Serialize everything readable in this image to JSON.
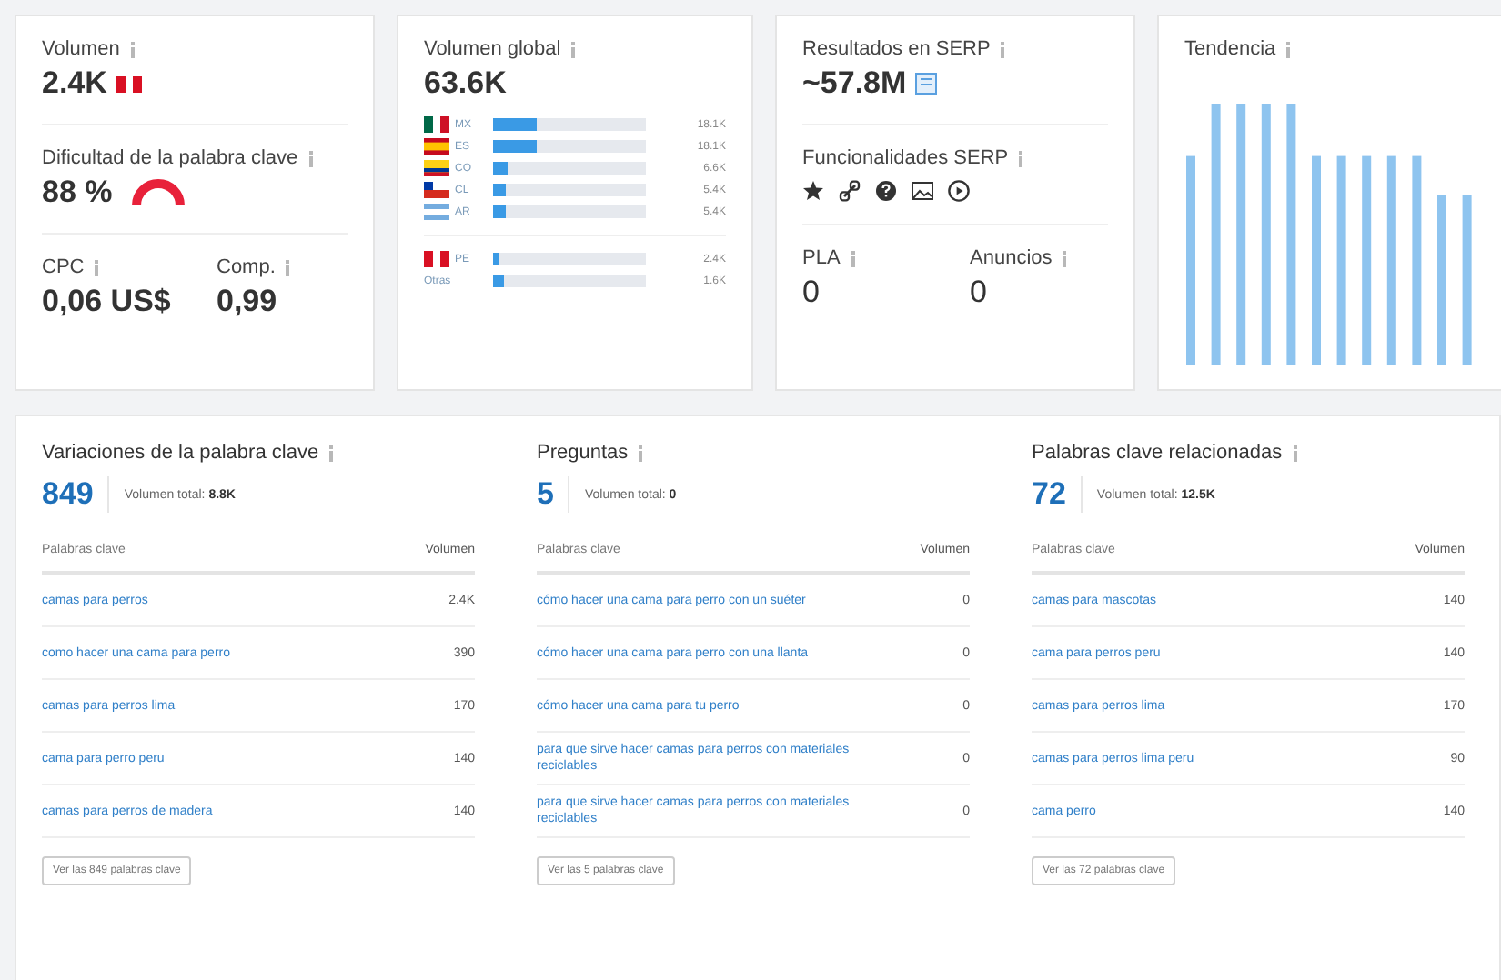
{
  "volume": {
    "label": "Volumen",
    "value": "2.4K"
  },
  "difficulty": {
    "label": "Dificultad de la palabra clave",
    "value": "88 %"
  },
  "cpc": {
    "label": "CPC",
    "value": "0,06 US$"
  },
  "competition": {
    "label": "Comp.",
    "value": "0,99"
  },
  "global_volume": {
    "label": "Volumen global",
    "value": "63.6K",
    "countries": [
      {
        "code": "MX",
        "level": 0.28,
        "value": "18.1K"
      },
      {
        "code": "ES",
        "level": 0.28,
        "value": "18.1K"
      },
      {
        "code": "CO",
        "level": 0.1,
        "value": "6.6K"
      },
      {
        "code": "CL",
        "level": 0.08,
        "value": "5.4K"
      },
      {
        "code": "AR",
        "level": 0.08,
        "value": "5.4K"
      }
    ],
    "others": [
      {
        "code": "PE",
        "level": 0.04,
        "value": "2.4K"
      },
      {
        "code": "Otras",
        "level": 0.07,
        "value": "1.6K"
      }
    ]
  },
  "serp_results": {
    "label": "Resultados en SERP",
    "value": "~57.8M"
  },
  "serp_features": {
    "label": "Funcionalidades SERP",
    "items": [
      {
        "kind": "star"
      },
      {
        "kind": "link"
      },
      {
        "kind": "question"
      },
      {
        "kind": "image"
      },
      {
        "kind": "video"
      }
    ]
  },
  "pla": {
    "label": "PLA",
    "value": "0"
  },
  "ads": {
    "label": "Anuncios",
    "value": "0"
  },
  "trend": {
    "label": "Tendencia"
  },
  "sections": [
    {
      "title": "Variaciones de la palabra clave",
      "count": "849",
      "total_label": "Volumen total:",
      "total": "8.8K",
      "columns": [
        "Palabras clave",
        "Volumen"
      ],
      "rows": [
        [
          "camas para perros",
          "2.4K"
        ],
        [
          "como hacer una cama para perro",
          "390"
        ],
        [
          "camas para perros lima",
          "170"
        ],
        [
          "cama para perro peru",
          "140"
        ],
        [
          "camas para perros de madera",
          "140"
        ]
      ],
      "button": "Ver las 849 palabras clave"
    },
    {
      "title": "Preguntas",
      "count": "5",
      "total_label": "Volumen total:",
      "total": "0",
      "columns": [
        "Palabras clave",
        "Volumen"
      ],
      "rows": [
        [
          "cómo hacer una cama para perro con un suéter",
          "0"
        ],
        [
          "cómo hacer una cama para perro con una llanta",
          "0"
        ],
        [
          "cómo hacer una cama para tu perro",
          "0"
        ],
        [
          "para que sirve hacer camas para perros con materiales reciclables",
          "0"
        ],
        [
          "para que sirve hacer camas para perros con materiales reciclables",
          "0"
        ]
      ],
      "button": "Ver las 5 palabras clave"
    },
    {
      "title": "Palabras clave relacionadas",
      "count": "72",
      "total_label": "Volumen total:",
      "total": "12.5K",
      "columns": [
        "Palabras clave",
        "Volumen"
      ],
      "rows": [
        [
          "camas para mascotas",
          "140"
        ],
        [
          "cama para perros peru",
          "140"
        ],
        [
          "camas para perros lima",
          "170"
        ],
        [
          "camas para perros lima peru",
          "90"
        ],
        [
          "cama perro",
          "140"
        ]
      ],
      "button": "Ver las 72 palabras clave"
    }
  ]
}
